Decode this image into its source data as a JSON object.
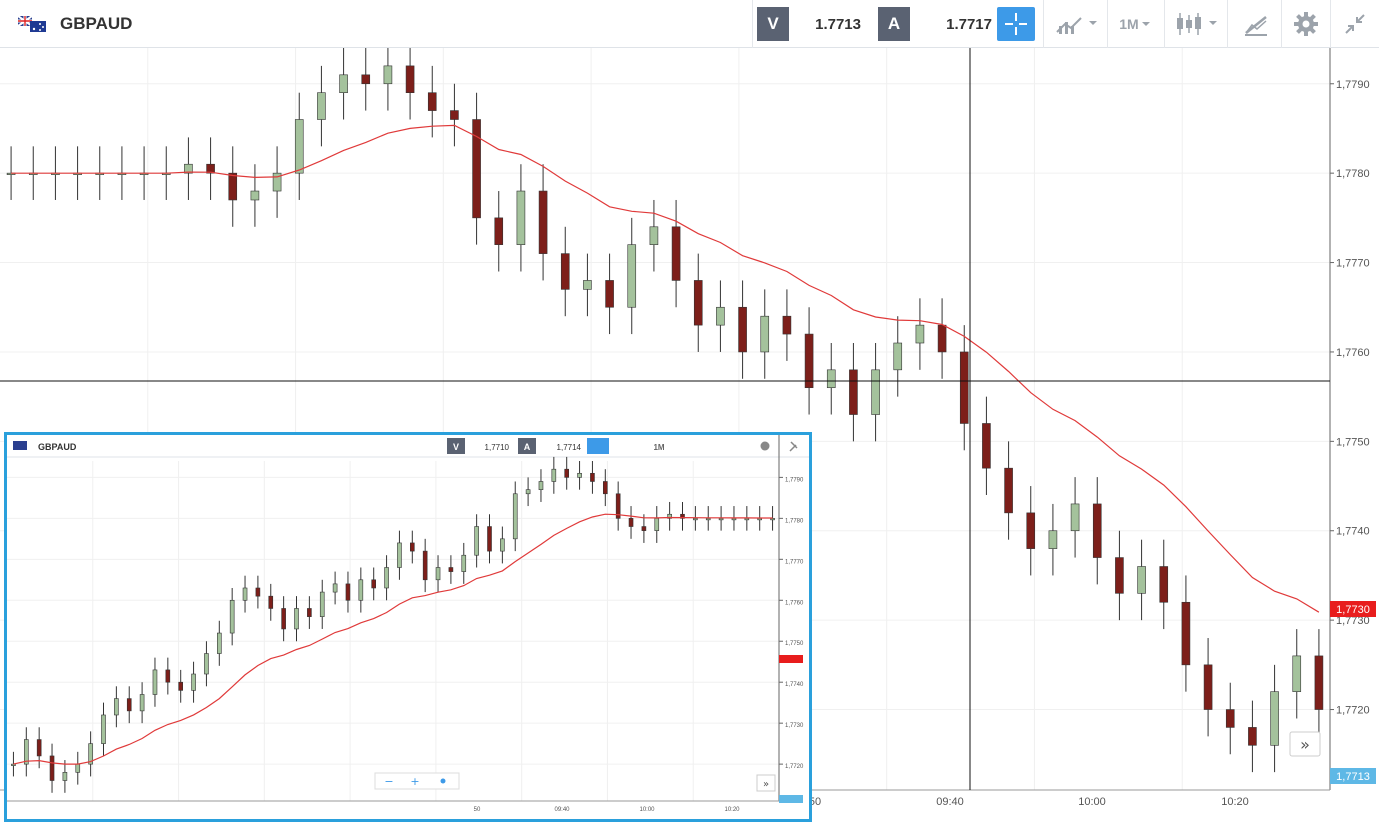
{
  "header": {
    "symbol": "GBPAUD",
    "sell_label": "V",
    "sell_price": "1.7713",
    "buy_label": "A",
    "buy_price": "1.7717",
    "timeframe_label": "1M"
  },
  "icons": {
    "flag": "gb-au-flag-icon",
    "crosshair": "crosshair-icon",
    "compare": "compare-icon",
    "timeframe_dropdown": "chevron-down-icon",
    "chart_type": "candlestick-icon",
    "drawing": "drawing-tool-icon",
    "settings": "gear-icon",
    "shrink": "shrink-icon",
    "scroll_right": "double-chevron-right-icon"
  },
  "colors": {
    "bull": "#a4c29c",
    "bear": "#7d1f1a",
    "ma": "#e03a3a",
    "accent": "#3d9ae8",
    "last_price_bg": "#e81d1d",
    "crosshair_label_bg": "#5eb8e6"
  },
  "main_chart": {
    "price_ticks": [
      "1,7790",
      "1,7780",
      "1,7770",
      "1,7760",
      "1,7750",
      "1,7740",
      "1,7730",
      "1,7720"
    ],
    "time_ticks": [
      "50",
      "09:40",
      "10:00",
      "10:20"
    ],
    "ma_value_label": "1,7730",
    "crosshair_value_label": "1,7713",
    "scroll_button_label": "»"
  },
  "inset_chart": {
    "symbol": "GBPAUD",
    "sell_label": "V",
    "sell_price": "1,7710",
    "buy_label": "A",
    "buy_price": "1,7714",
    "timeframe_label": "1M",
    "zoom_out": "−",
    "zoom_in": "+",
    "scroll_button_label": "»"
  },
  "chart_data": {
    "type": "candlestick",
    "ylim": [
      1.7711,
      1.7794
    ],
    "price_ticks": [
      1.779,
      1.778,
      1.777,
      1.776,
      1.775,
      1.774,
      1.773,
      1.772
    ],
    "time_ticks": [
      "50",
      "09:40",
      "10:00",
      "10:20"
    ],
    "moving_average_last": 1.773,
    "candle_close_path": [
      1.778,
      1.778,
      1.778,
      1.778,
      1.778,
      1.778,
      1.778,
      1.778,
      1.7781,
      1.778,
      1.7777,
      1.7778,
      1.778,
      1.7786,
      1.7789,
      1.7791,
      1.779,
      1.7792,
      1.7789,
      1.7787,
      1.7786,
      1.7775,
      1.7772,
      1.7778,
      1.7771,
      1.7767,
      1.7768,
      1.7765,
      1.7772,
      1.7774,
      1.7768,
      1.7763,
      1.7765,
      1.776,
      1.7764,
      1.7762,
      1.7756,
      1.7758,
      1.7753,
      1.7758,
      1.7761,
      1.7763,
      1.776,
      1.7752,
      1.7747,
      1.7742,
      1.7738,
      1.774,
      1.7743,
      1.7737,
      1.7733,
      1.7736,
      1.7732,
      1.7725,
      1.772,
      1.7718,
      1.7716,
      1.7722,
      1.7726,
      1.772
    ]
  }
}
